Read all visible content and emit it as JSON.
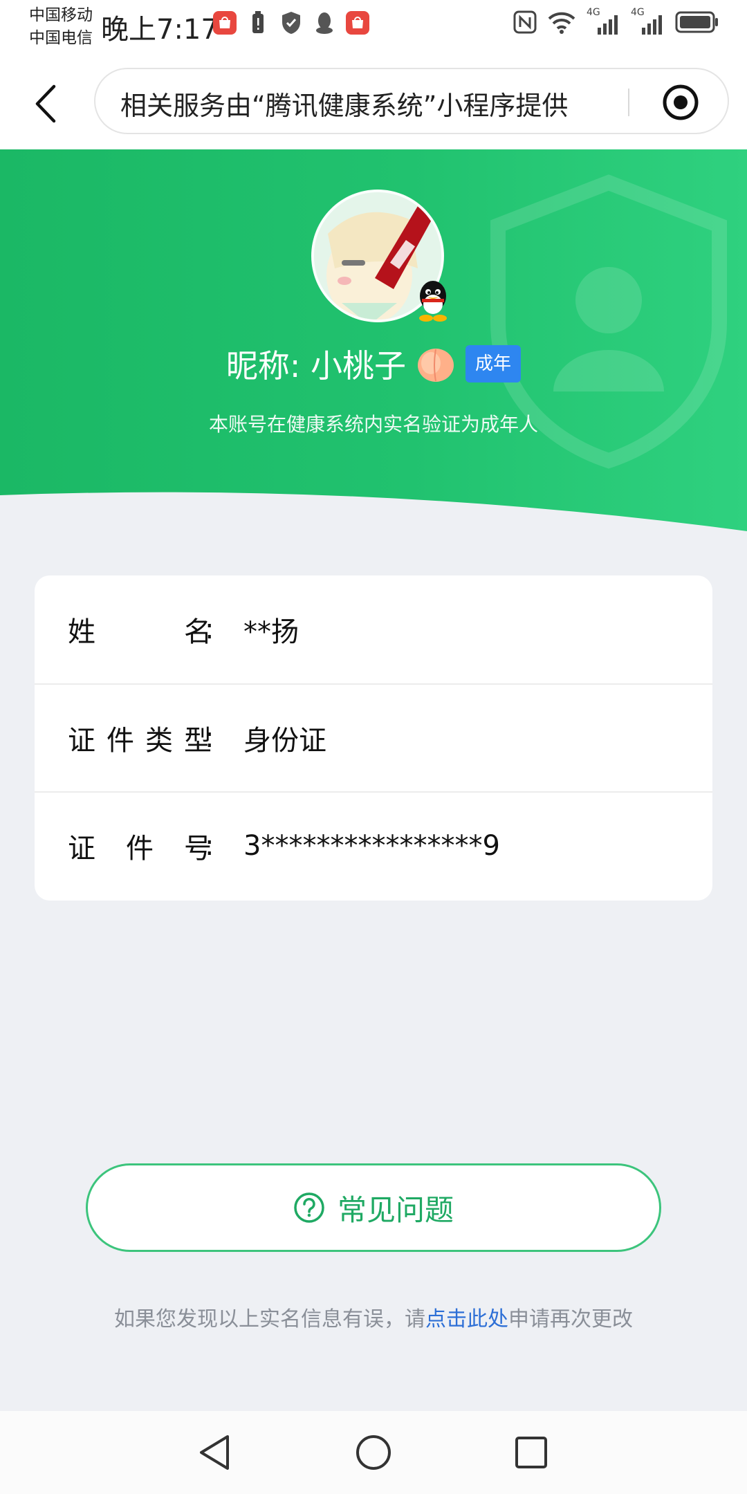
{
  "status_bar": {
    "carrier_1": "中国移动",
    "carrier_2": "中国电信",
    "time": "晚上7:17",
    "network_1": "4G",
    "network_2": "4G",
    "icons": [
      "huawei-store-icon",
      "battery-alert-icon",
      "shield-check-icon",
      "qq-icon",
      "huawei-store-icon",
      "nfc-icon",
      "wifi-icon",
      "signal-icon",
      "signal-icon",
      "battery-icon"
    ]
  },
  "navbar": {
    "service_text": "相关服务由“腾讯健康系统”小程序提供"
  },
  "profile": {
    "nickname": "昵称: 小桃子",
    "adult_badge": "成年",
    "verify_note": "本账号在健康系统内实名验证为成年人"
  },
  "info": {
    "rows": [
      {
        "label_chars": [
          "姓",
          "名"
        ],
        "colon": ":",
        "value": "**扬"
      },
      {
        "label_chars": [
          "证",
          "件",
          "类",
          "型"
        ],
        "colon": ":",
        "value": "身份证"
      },
      {
        "label_chars": [
          "证",
          "件",
          "号"
        ],
        "colon": ":",
        "value": "3****************9"
      }
    ]
  },
  "faq": {
    "label": "常见问题"
  },
  "correction": {
    "prefix": "如果您发现以上实名信息有误，请",
    "link": "点击此处",
    "suffix": "申请再次更改"
  },
  "colors": {
    "primary_green": "#22c06e",
    "badge_blue": "#2e86f0",
    "link_blue": "#2d6fd6"
  }
}
